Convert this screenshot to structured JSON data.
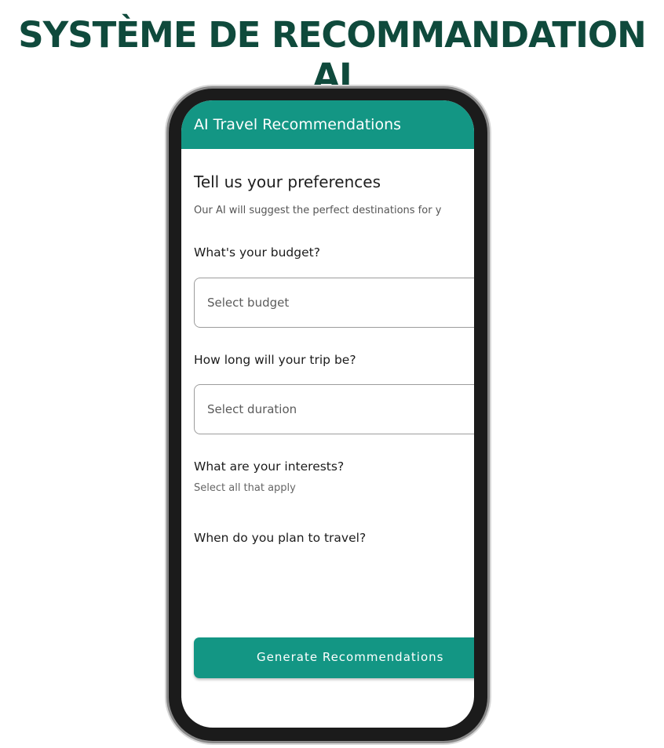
{
  "page": {
    "title": "SYSTÈME DE RECOMMANDATION AI"
  },
  "app": {
    "appbar_title": "AI Travel Recommendations",
    "heading": "Tell us your preferences",
    "subtext": "Our AI will suggest the perfect destinations for y",
    "budget": {
      "label": "What's your budget?",
      "placeholder": "Select budget"
    },
    "duration": {
      "label": "How long will your trip be?",
      "placeholder": "Select duration"
    },
    "interests": {
      "label": "What are your interests?",
      "hint": "Select all that apply"
    },
    "travel_time": {
      "label": "When do you plan to travel?"
    },
    "generate_button": "Generate Recommendations"
  },
  "colors": {
    "title": "#0f4a3c",
    "accent": "#139684"
  }
}
